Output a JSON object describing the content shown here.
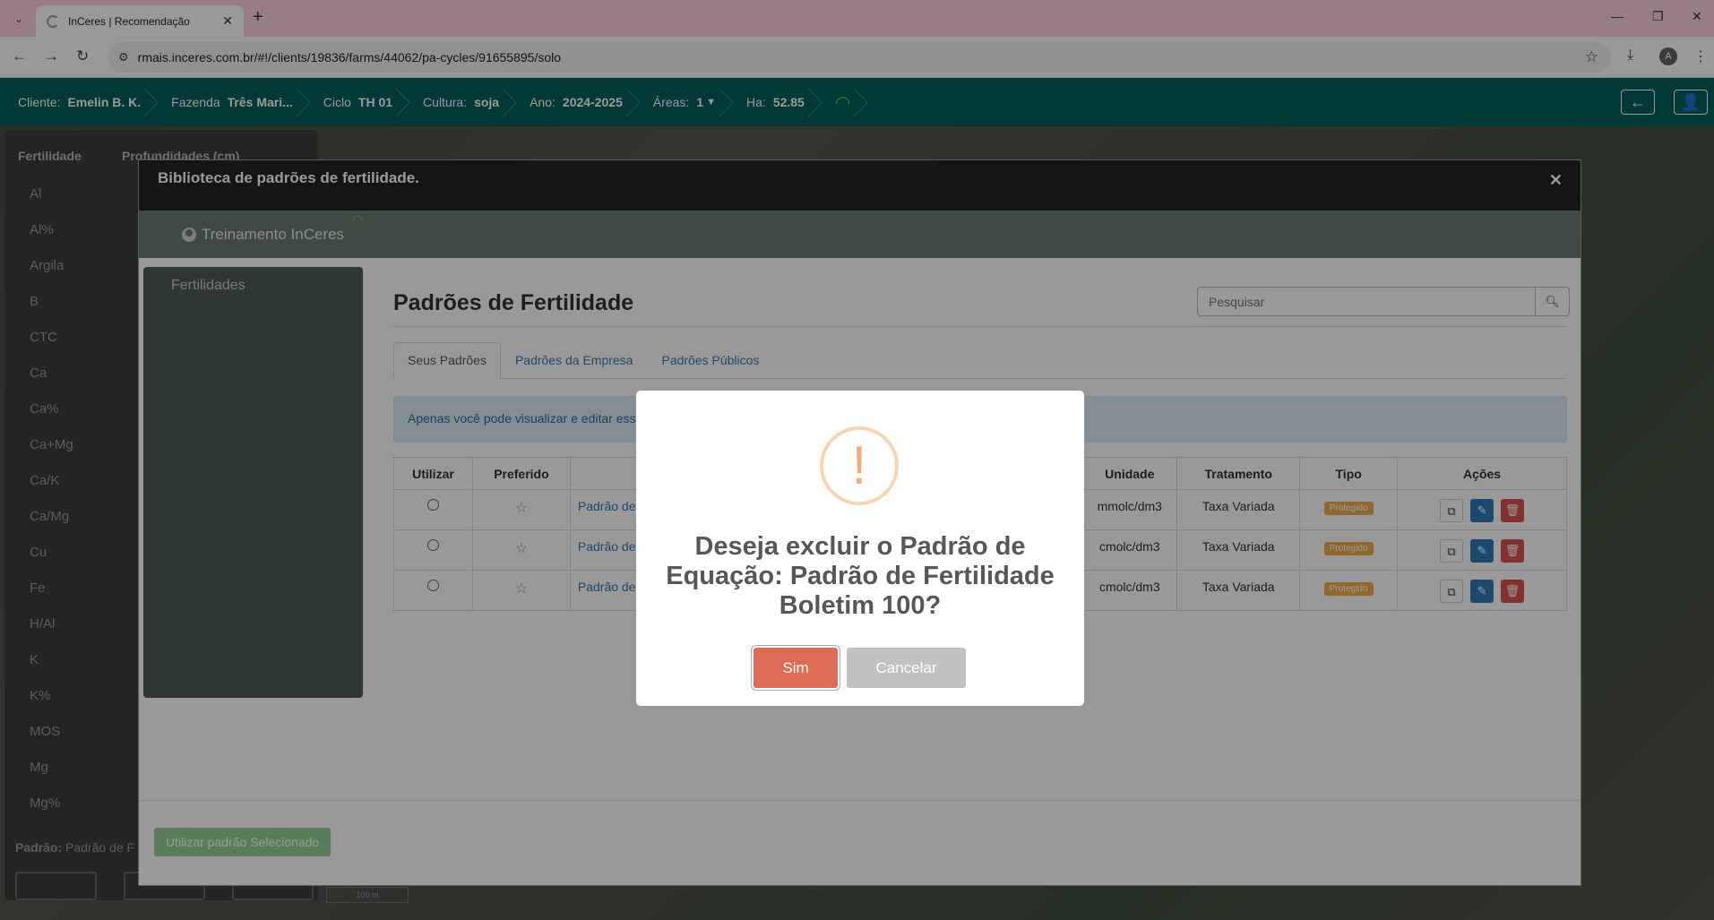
{
  "browser": {
    "tab_title": "InCeres | Recomendação",
    "url": "rmais.inceres.com.br/#!/clients/19836/farms/44062/pa-cycles/91655895/solo",
    "profile_initial": "A"
  },
  "header": {
    "crumbs": [
      {
        "label": "Cliente:",
        "value": "Emelin B. K."
      },
      {
        "label": "Fazenda",
        "value": "Três Mari..."
      },
      {
        "label": "Ciclo",
        "value": "TH 01"
      },
      {
        "label": "Cultura:",
        "value": "soja"
      },
      {
        "label": "Ano:",
        "value": "2024-2025"
      },
      {
        "label": "Áreas:",
        "value": "1"
      },
      {
        "label": "Ha:",
        "value": "52.85"
      }
    ]
  },
  "side": {
    "col1": "Fertilidade",
    "col2": "Profundidades (cm)",
    "items": [
      "Al",
      "Al%",
      "Argila",
      "B",
      "CTC",
      "Ca",
      "Ca%",
      "Ca+Mg",
      "Ca/K",
      "Ca/Mg",
      "Cu",
      "Fe",
      "H/Al",
      "K",
      "K%",
      "MOS",
      "Mg",
      "Mg%"
    ],
    "padrao_label": "Padrão:",
    "padrao_value": "Padrão de F",
    "scale": "100 m"
  },
  "dialog": {
    "title": "Biblioteca de padrões de fertilidade.",
    "user": "Treinamento InCeres",
    "nav_item": "Fertilidades",
    "page_title": "Padrões de Fertilidade",
    "search_placeholder": "Pesquisar",
    "tabs": [
      "Seus Padrões",
      "Padrões da Empresa",
      "Padrões Públicos"
    ],
    "alert": "Apenas você pode visualizar e editar esse",
    "columns": [
      "Utilizar",
      "Preferido",
      "",
      "Unidade",
      "Tratamento",
      "Tipo",
      "Ações"
    ],
    "rows": [
      {
        "name": "Padrão de",
        "unit": "mmolc/dm3",
        "treatment": "Taxa Variada",
        "type": "Protegido"
      },
      {
        "name": "Padrão de",
        "unit": "cmolc/dm3",
        "treatment": "Taxa Variada",
        "type": "Protegido"
      },
      {
        "name": "Padrão de",
        "unit": "cmolc/dm3",
        "treatment": "Taxa Variada",
        "type": "Protegido"
      }
    ],
    "use_button": "Utilizar padrão Selecionado"
  },
  "confirm": {
    "icon": "!",
    "question": "Deseja excluir o Padrão de Equação: Padrão de Fertilidade Boletim 100?",
    "yes": "Sim",
    "no": "Cancelar"
  },
  "colors": {
    "header": "#005f5b",
    "danger": "#dd6b55",
    "warning": "#f0ad4e"
  }
}
